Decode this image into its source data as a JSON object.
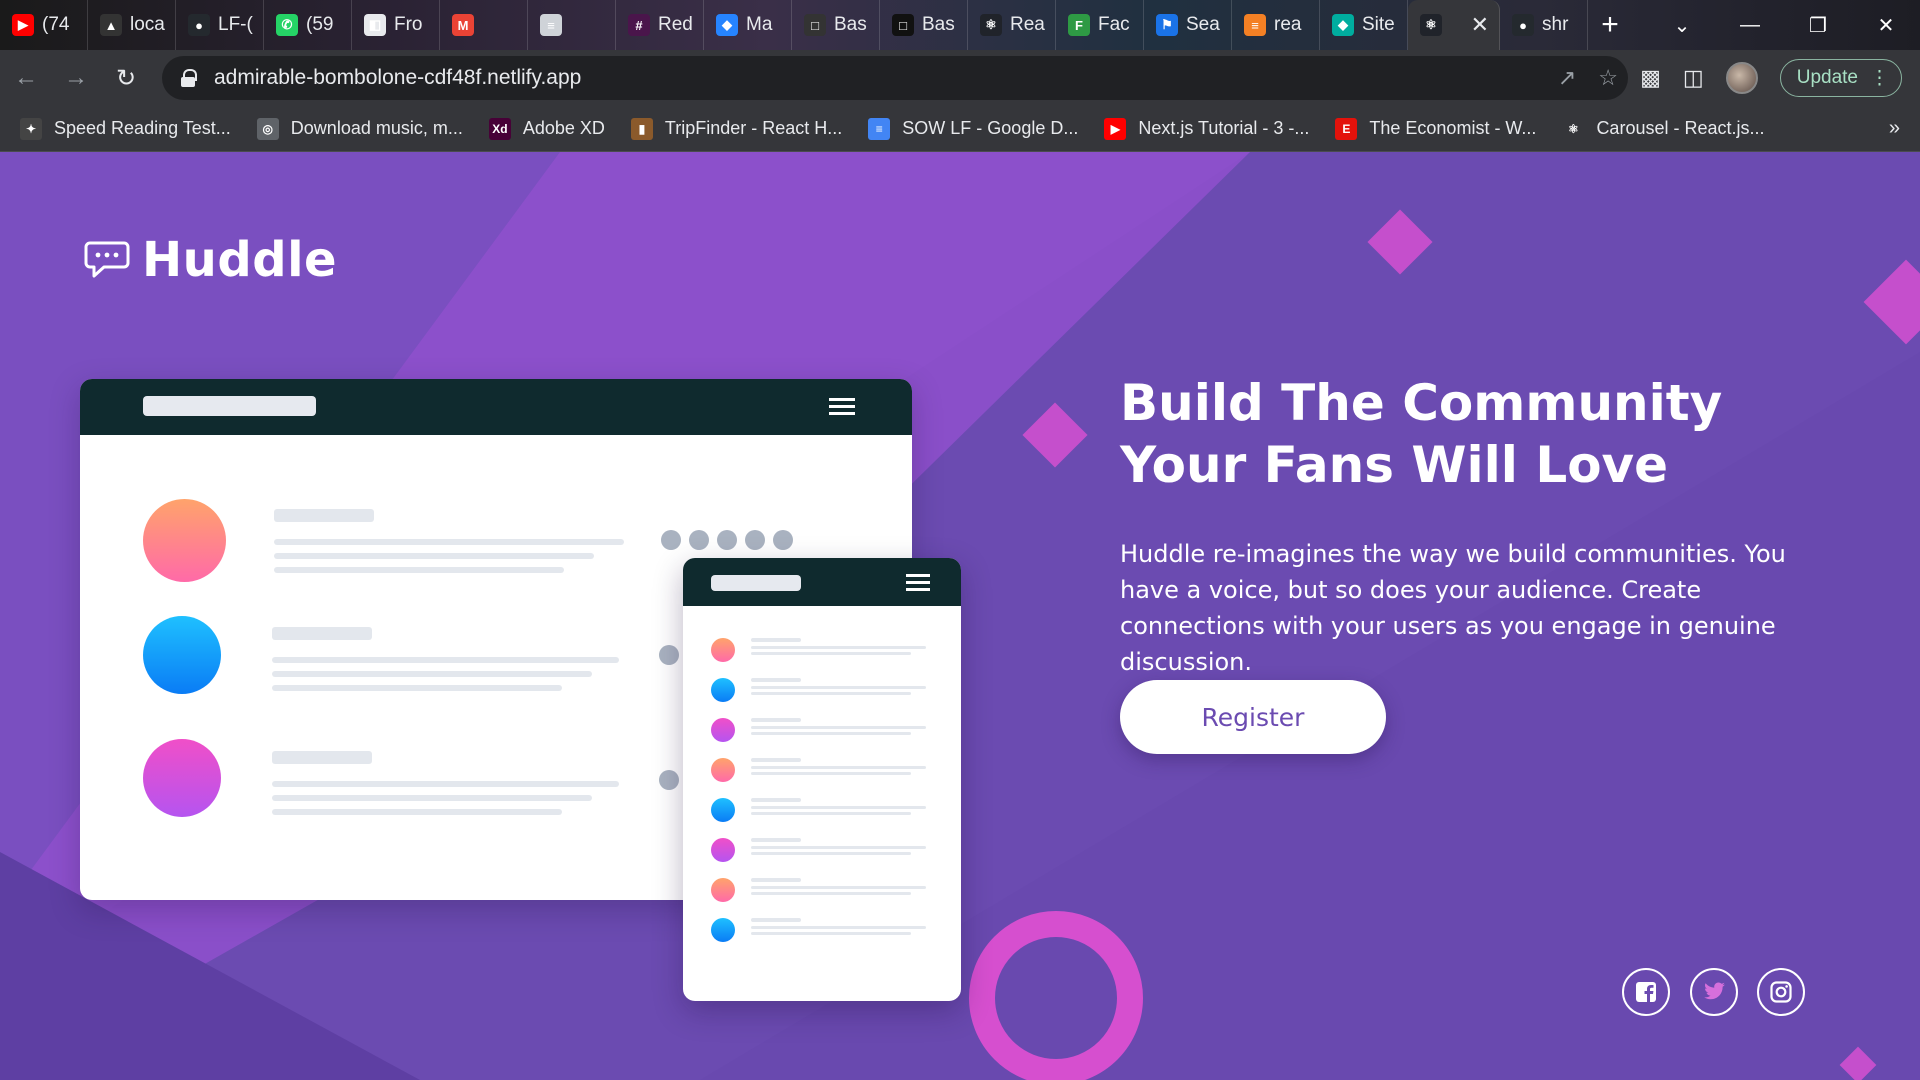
{
  "browser": {
    "tabs": [
      {
        "label": "(74",
        "icon": "youtube-icon",
        "color": "#ff0000"
      },
      {
        "label": "loca",
        "icon": "triangle-icon",
        "color": "#333333"
      },
      {
        "label": "LF-(",
        "icon": "github-icon",
        "color": "#24292e"
      },
      {
        "label": "(59",
        "icon": "whatsapp-icon",
        "color": "#25d366"
      },
      {
        "label": "Fro",
        "icon": "page-icon",
        "color": "#e8eaed"
      },
      {
        "label": "",
        "icon": "gmail-icon",
        "color": "#ea4335"
      },
      {
        "label": "",
        "icon": "docs-icon",
        "color": "#cfd3d8"
      },
      {
        "label": "Red",
        "icon": "slack-icon",
        "color": "#4a154b"
      },
      {
        "label": "Ma",
        "icon": "jira-icon",
        "color": "#2684ff"
      },
      {
        "label": "Bas",
        "icon": "square-icon",
        "color": "#333333"
      },
      {
        "label": "Bas",
        "icon": "square-icon",
        "color": "#111111"
      },
      {
        "label": "Rea",
        "icon": "react-icon",
        "color": "#20232a"
      },
      {
        "label": "Fac",
        "icon": "frontend-mentor-icon",
        "color": "#2e9a44"
      },
      {
        "label": "Sea",
        "icon": "flag-icon",
        "color": "#1a73e8"
      },
      {
        "label": "rea",
        "icon": "stackoverflow-icon",
        "color": "#f48024"
      },
      {
        "label": "Site",
        "icon": "netlify-icon",
        "color": "#00ad9f"
      },
      {
        "label": "",
        "icon": "react-icon",
        "color": "#20232a"
      },
      {
        "label": "shr",
        "icon": "github-icon",
        "color": "#24292e"
      }
    ],
    "new_tab": "+",
    "url": "admirable-bombolone-cdf48f.netlify.app",
    "update_label": "Update",
    "bookmarks": [
      {
        "label": "Speed Reading Test...",
        "icon": "eagle-icon",
        "color": "#444444"
      },
      {
        "label": "Download music, m...",
        "icon": "globe-icon",
        "color": "#5f6368"
      },
      {
        "label": "Adobe XD",
        "icon": "xd-icon",
        "color": "#470137"
      },
      {
        "label": "TripFinder - React H...",
        "icon": "tripfinder-icon",
        "color": "#8b5a2b"
      },
      {
        "label": "SOW LF - Google D...",
        "icon": "docs-icon",
        "color": "#4285f4"
      },
      {
        "label": "Next.js Tutorial - 3 -...",
        "icon": "youtube-icon",
        "color": "#ff0000"
      },
      {
        "label": "The Economist - W...",
        "icon": "economist-icon",
        "color": "#e3120b"
      },
      {
        "label": "Carousel - React.js...",
        "icon": "react-icon",
        "color": "#35363a"
      }
    ],
    "bookmarks_more": "»"
  },
  "page": {
    "logo_text": "Huddle",
    "headline": "Build The Community Your Fans Will Love",
    "description": "Huddle re-imagines the way we build communities. You have a voice, but so does your audience. Create connections with your users as you engage in genuine discussion.",
    "register_label": "Register",
    "social": [
      "facebook-icon",
      "twitter-icon",
      "instagram-icon"
    ],
    "colors": {
      "background": "#6b4bb1",
      "accent": "#c84fd0",
      "mock_bar": "#0f2a2e"
    }
  }
}
